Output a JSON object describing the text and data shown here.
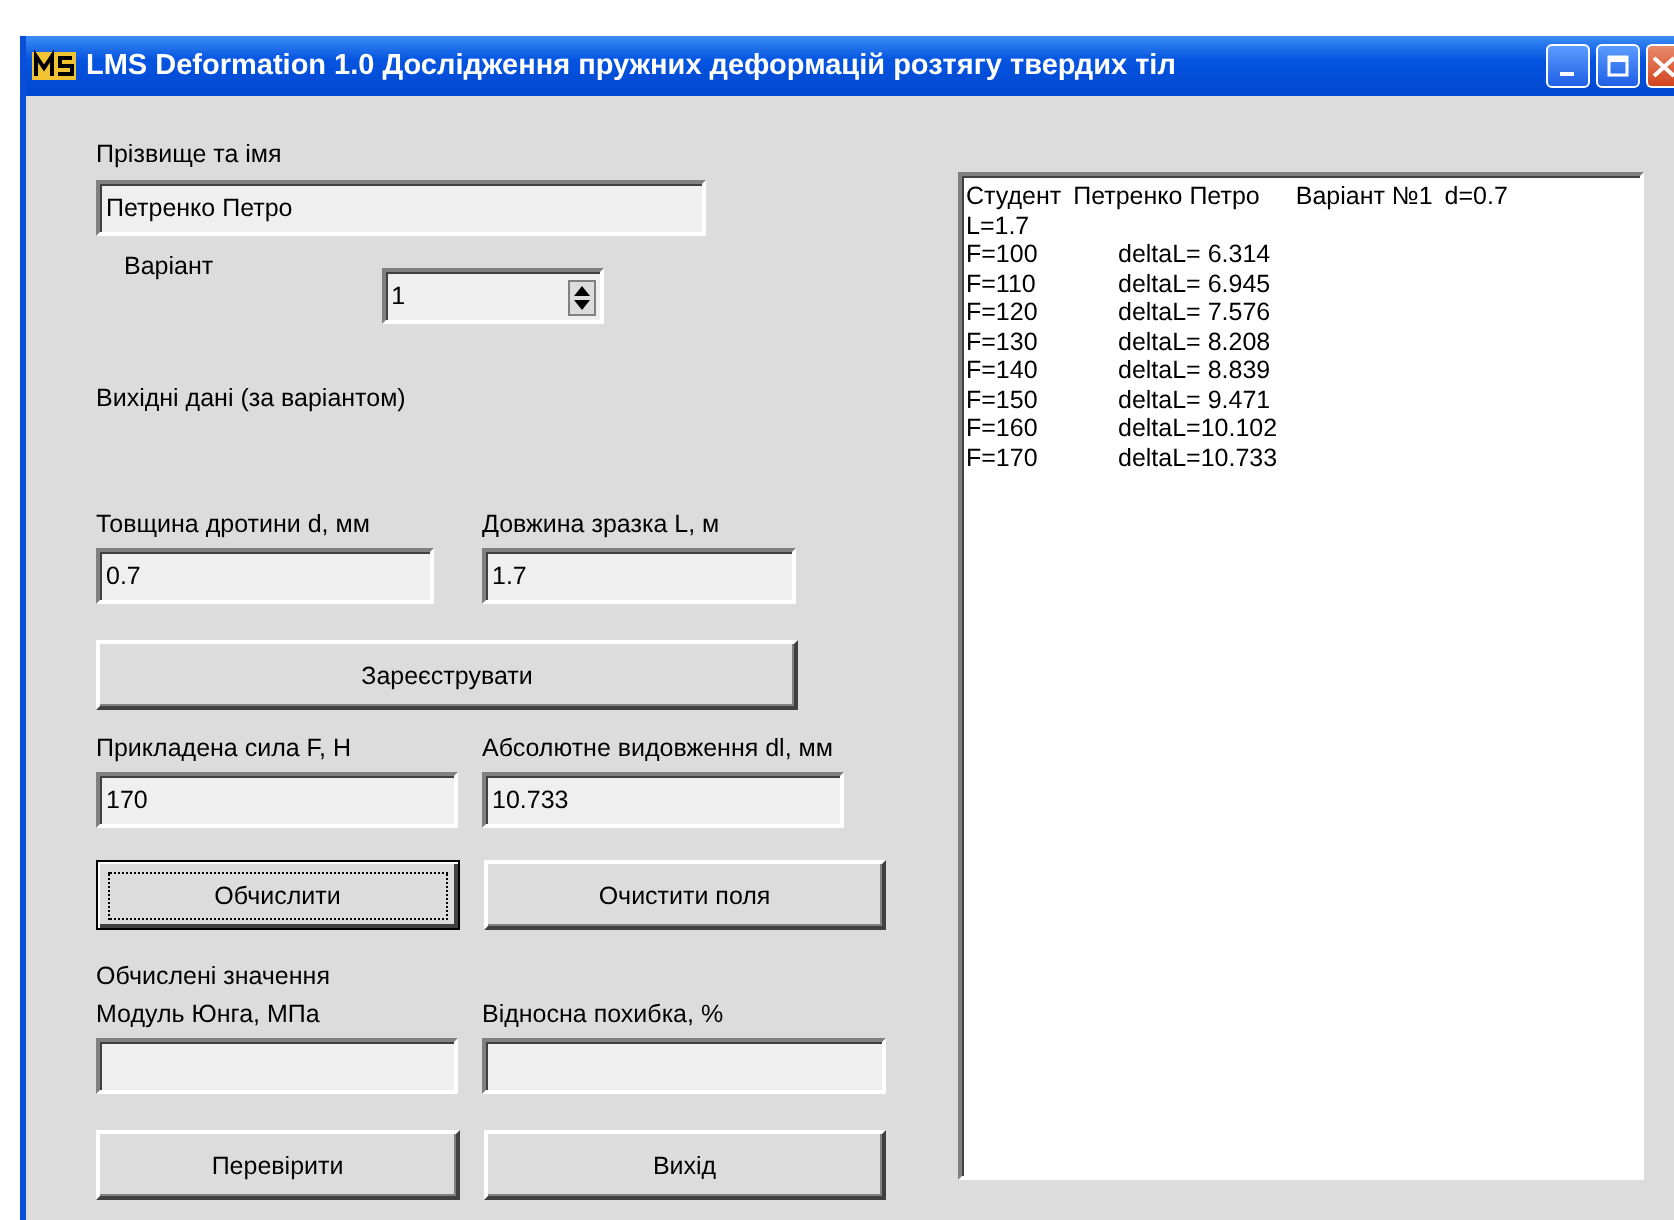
{
  "window": {
    "title": "LMS Deformation 1.0 Дослідження пружних деформацій розтягу твердих тіл",
    "controls": [
      {
        "kind": "minimize"
      },
      {
        "kind": "maximize"
      },
      {
        "kind": "close"
      }
    ]
  },
  "name": {
    "label": "Прізвище та імя",
    "value": "Петренко Петро"
  },
  "variant": {
    "label": "Варіант",
    "value": "1"
  },
  "input_heading": "Вихідні дані (за варіантом)",
  "wire_fields": [
    {
      "label": "Товщина дротини d, мм",
      "value": "0.7"
    },
    {
      "label": "Довжина зразка L, м",
      "value": "1.7"
    }
  ],
  "register_button": {
    "label": "Зареєструвати",
    "focused": false
  },
  "measure_fields": [
    {
      "label": "Прикладена сила F, Н",
      "value": "170"
    },
    {
      "label": "Абсолютне видовження dl, мм",
      "value": "10.733"
    }
  ],
  "action_buttons": [
    {
      "label": "Обчислити",
      "focused": true
    },
    {
      "label": "Очистити поля",
      "focused": false
    }
  ],
  "results_heading": "Обчислені значення",
  "result_fields": [
    {
      "label": "Модуль Юнга, МПа"
    },
    {
      "label": "Відносна похибка, %"
    }
  ],
  "bottom_buttons": [
    {
      "label": "Перевірити",
      "focused": false
    },
    {
      "label": "Вихід",
      "focused": false
    }
  ],
  "log": [
    {
      "kind": "header",
      "parts": [
        "Студент",
        "Петренко Петро",
        "Варіант №1",
        "d=0.7"
      ]
    },
    {
      "kind": "data",
      "parts": [
        "L=1.7"
      ]
    },
    {
      "kind": "data",
      "parts": [
        "F=100",
        "deltaL= 6.314"
      ]
    },
    {
      "kind": "data",
      "parts": [
        "F=110",
        "deltaL= 6.945"
      ]
    },
    {
      "kind": "data",
      "parts": [
        "F=120",
        "deltaL= 7.576"
      ]
    },
    {
      "kind": "data",
      "parts": [
        "F=130",
        "deltaL= 8.208"
      ]
    },
    {
      "kind": "data",
      "parts": [
        "F=140",
        "deltaL= 8.839"
      ]
    },
    {
      "kind": "data",
      "parts": [
        "F=150",
        "deltaL= 9.471"
      ]
    },
    {
      "kind": "data",
      "parts": [
        "F=160",
        "deltaL=10.102"
      ]
    },
    {
      "kind": "data",
      "parts": [
        "F=170",
        "deltaL=10.733"
      ]
    }
  ]
}
